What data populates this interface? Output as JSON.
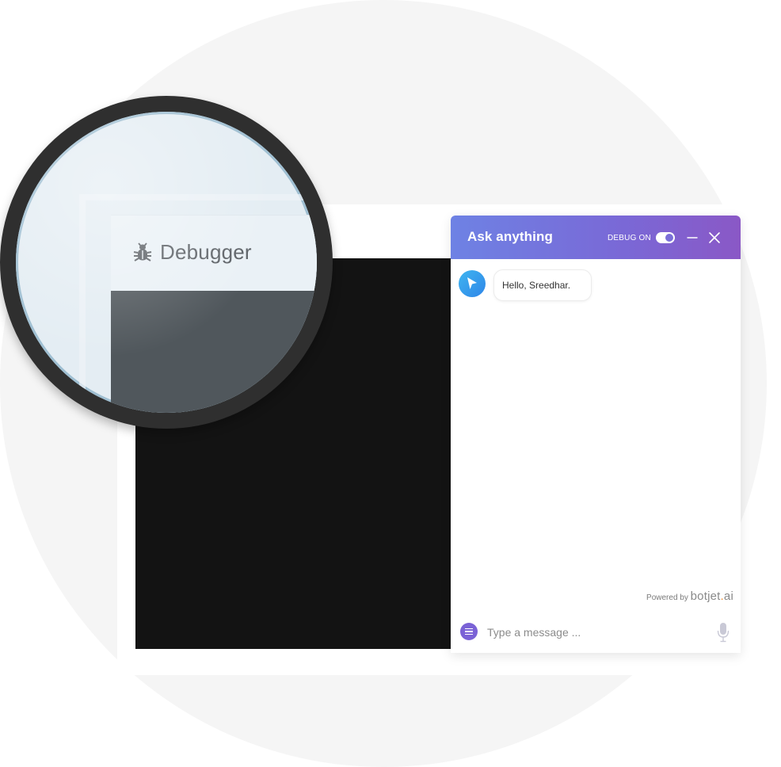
{
  "magnifier": {
    "title": "Debugger",
    "icon": "bug-icon"
  },
  "chat": {
    "title": "Ask anything",
    "debug_label": "DEBUG ON",
    "debug_enabled": true,
    "messages": [
      {
        "from": "bot",
        "text": "Hello, Sreedhar."
      }
    ],
    "powered_by_prefix": "Powered by",
    "brand": {
      "part1": "botjet",
      "dot": ".",
      "part2": "ai"
    },
    "input": {
      "value": "",
      "placeholder": "Type a message ..."
    },
    "icons": {
      "minimize": "minimize-icon",
      "close": "close-icon",
      "avatar": "bot-avatar-icon",
      "menu": "menu-icon",
      "mic": "microphone-icon"
    },
    "colors": {
      "header_start": "#6e82e4",
      "header_end": "#8a58c6",
      "accent": "#7a62d6",
      "brand_dot": "#f08a2d"
    }
  }
}
